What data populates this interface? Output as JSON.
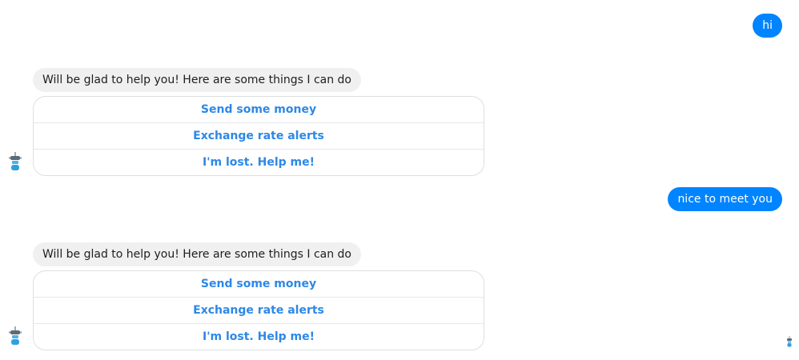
{
  "messages": {
    "user_1": "hi",
    "bot_1": {
      "text": "Will be glad to help you! Here are some things I can do",
      "replies": [
        "Send some money",
        "Exchange rate alerts",
        "I'm lost. Help me!"
      ]
    },
    "user_2": "nice to meet you",
    "bot_2": {
      "text": "Will be glad to help you! Here are some things I can do",
      "replies": [
        "Send some money",
        "Exchange rate alerts",
        "I'm lost. Help me!"
      ]
    }
  },
  "icons": {
    "bot_avatar": "robot-icon",
    "read_receipt": "robot-icon"
  },
  "colors": {
    "user_bubble": "#0084ff",
    "bot_bubble": "#f1f0f0",
    "quick_reply_text": "#2d88e6"
  }
}
